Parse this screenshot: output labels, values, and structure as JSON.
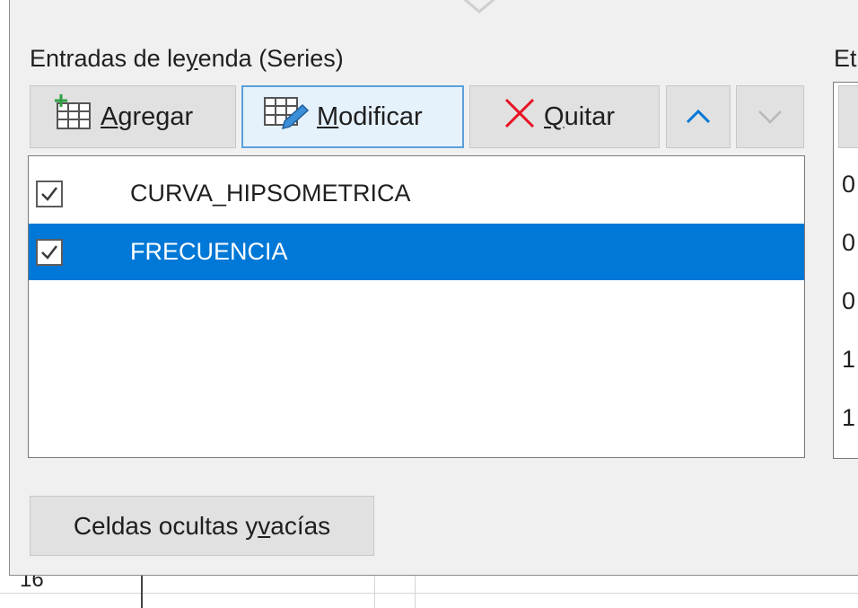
{
  "dialog": {
    "legend_heading_parts": [
      "Entradas de le",
      "y",
      "enda (Series)"
    ],
    "right_heading": "Et",
    "toolbar": {
      "add_label_parts": [
        "",
        "A",
        "gregar"
      ],
      "edit_label_parts": [
        "",
        "M",
        "odificar"
      ],
      "remove_label_parts": [
        "",
        "Q",
        "uitar"
      ],
      "move_up_icon": "chevron-up-icon",
      "move_down_icon": "chevron-down-icon",
      "accent_color": "#0078d7",
      "remove_color": "#e81123"
    },
    "series": [
      {
        "name": "CURVA_HIPSOMETRICA",
        "checked": true,
        "selected": false
      },
      {
        "name": "FRECUENCIA",
        "checked": true,
        "selected": true
      }
    ],
    "right_values": [
      "0",
      "0",
      "0",
      "1",
      "1"
    ],
    "hidden_cells_label_parts": [
      "Celdas ocultas y ",
      "v",
      "acías"
    ],
    "selection_color": "#0078d7"
  },
  "sheet": {
    "row_number": "16"
  }
}
